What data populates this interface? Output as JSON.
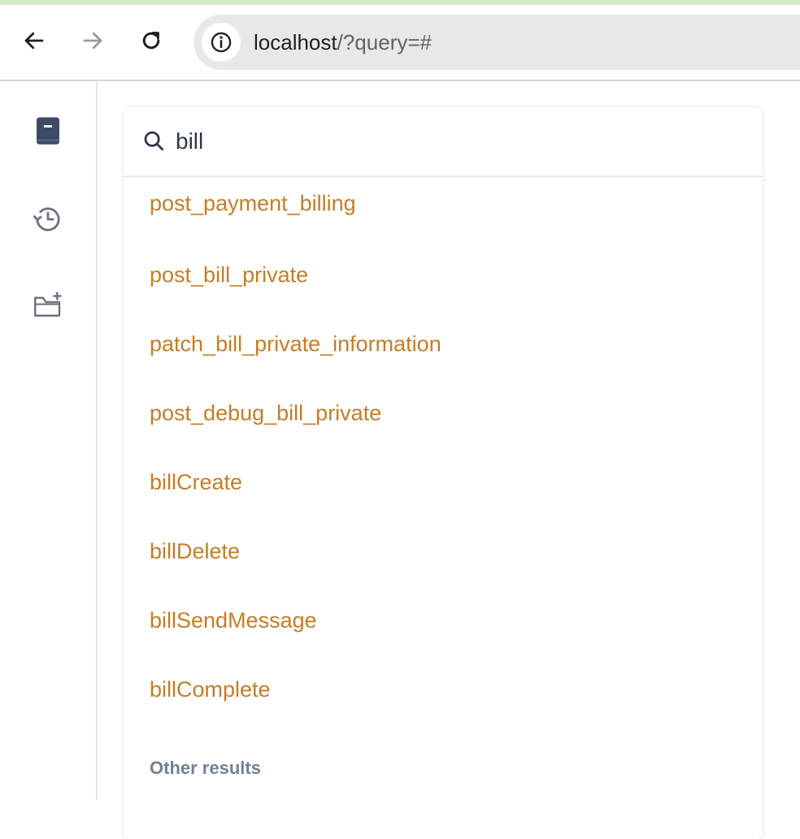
{
  "browser": {
    "url_host": "localhost",
    "url_path": "/?query=#"
  },
  "search": {
    "value": "bill"
  },
  "results": [
    "post_payment_billing",
    "post_bill_private",
    "patch_bill_private_information",
    "post_debug_bill_private",
    "billCreate",
    "billDelete",
    "billSendMessage",
    "billComplete"
  ],
  "other_results_label": "Other results",
  "colors": {
    "result_text": "#c47d26",
    "section_label": "#718096",
    "sidebar_icon_active": "#3d4a66",
    "sidebar_icon": "#6b7280"
  },
  "icons": {
    "sidebar": [
      "book-icon",
      "history-icon",
      "folder-plus-icon"
    ],
    "toolbar": [
      "back-arrow-icon",
      "forward-arrow-icon",
      "reload-icon",
      "info-icon"
    ]
  }
}
